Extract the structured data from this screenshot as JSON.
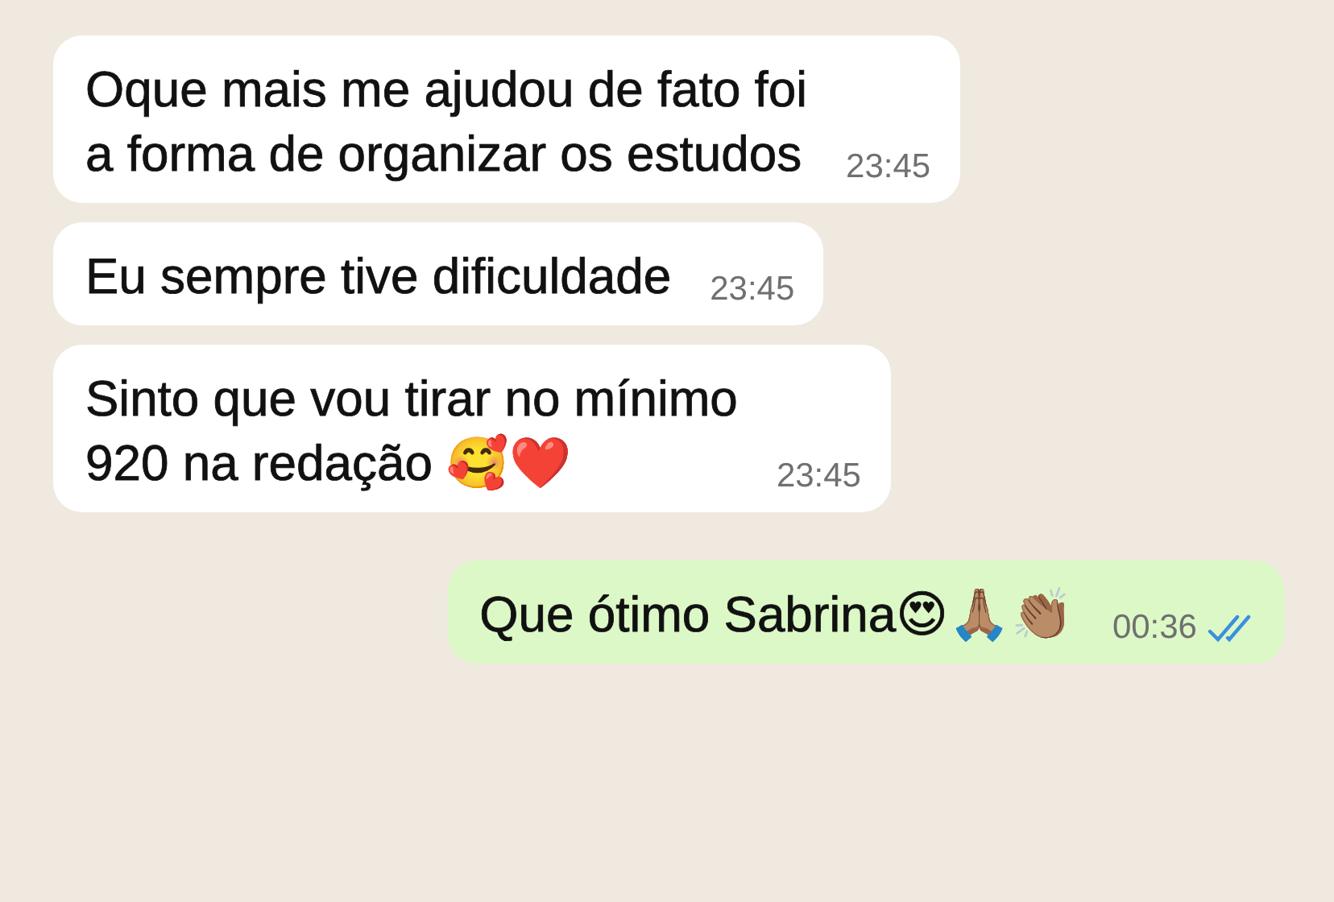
{
  "messages": [
    {
      "kind": "incoming",
      "text": "Oque mais me ajudou de fato foi\na forma de organizar os estudos",
      "time": "23:45"
    },
    {
      "kind": "incoming",
      "text": "Eu sempre tive dificuldade",
      "time": "23:45"
    },
    {
      "kind": "incoming",
      "text": "Sinto que vou tirar no mínimo\n920 na redação 🥰❤️",
      "time": "23:45"
    },
    {
      "kind": "outgoing",
      "text": "Que ótimo Sabrina😍🙏🏽👏🏽",
      "time": "00:36",
      "read": true
    }
  ]
}
